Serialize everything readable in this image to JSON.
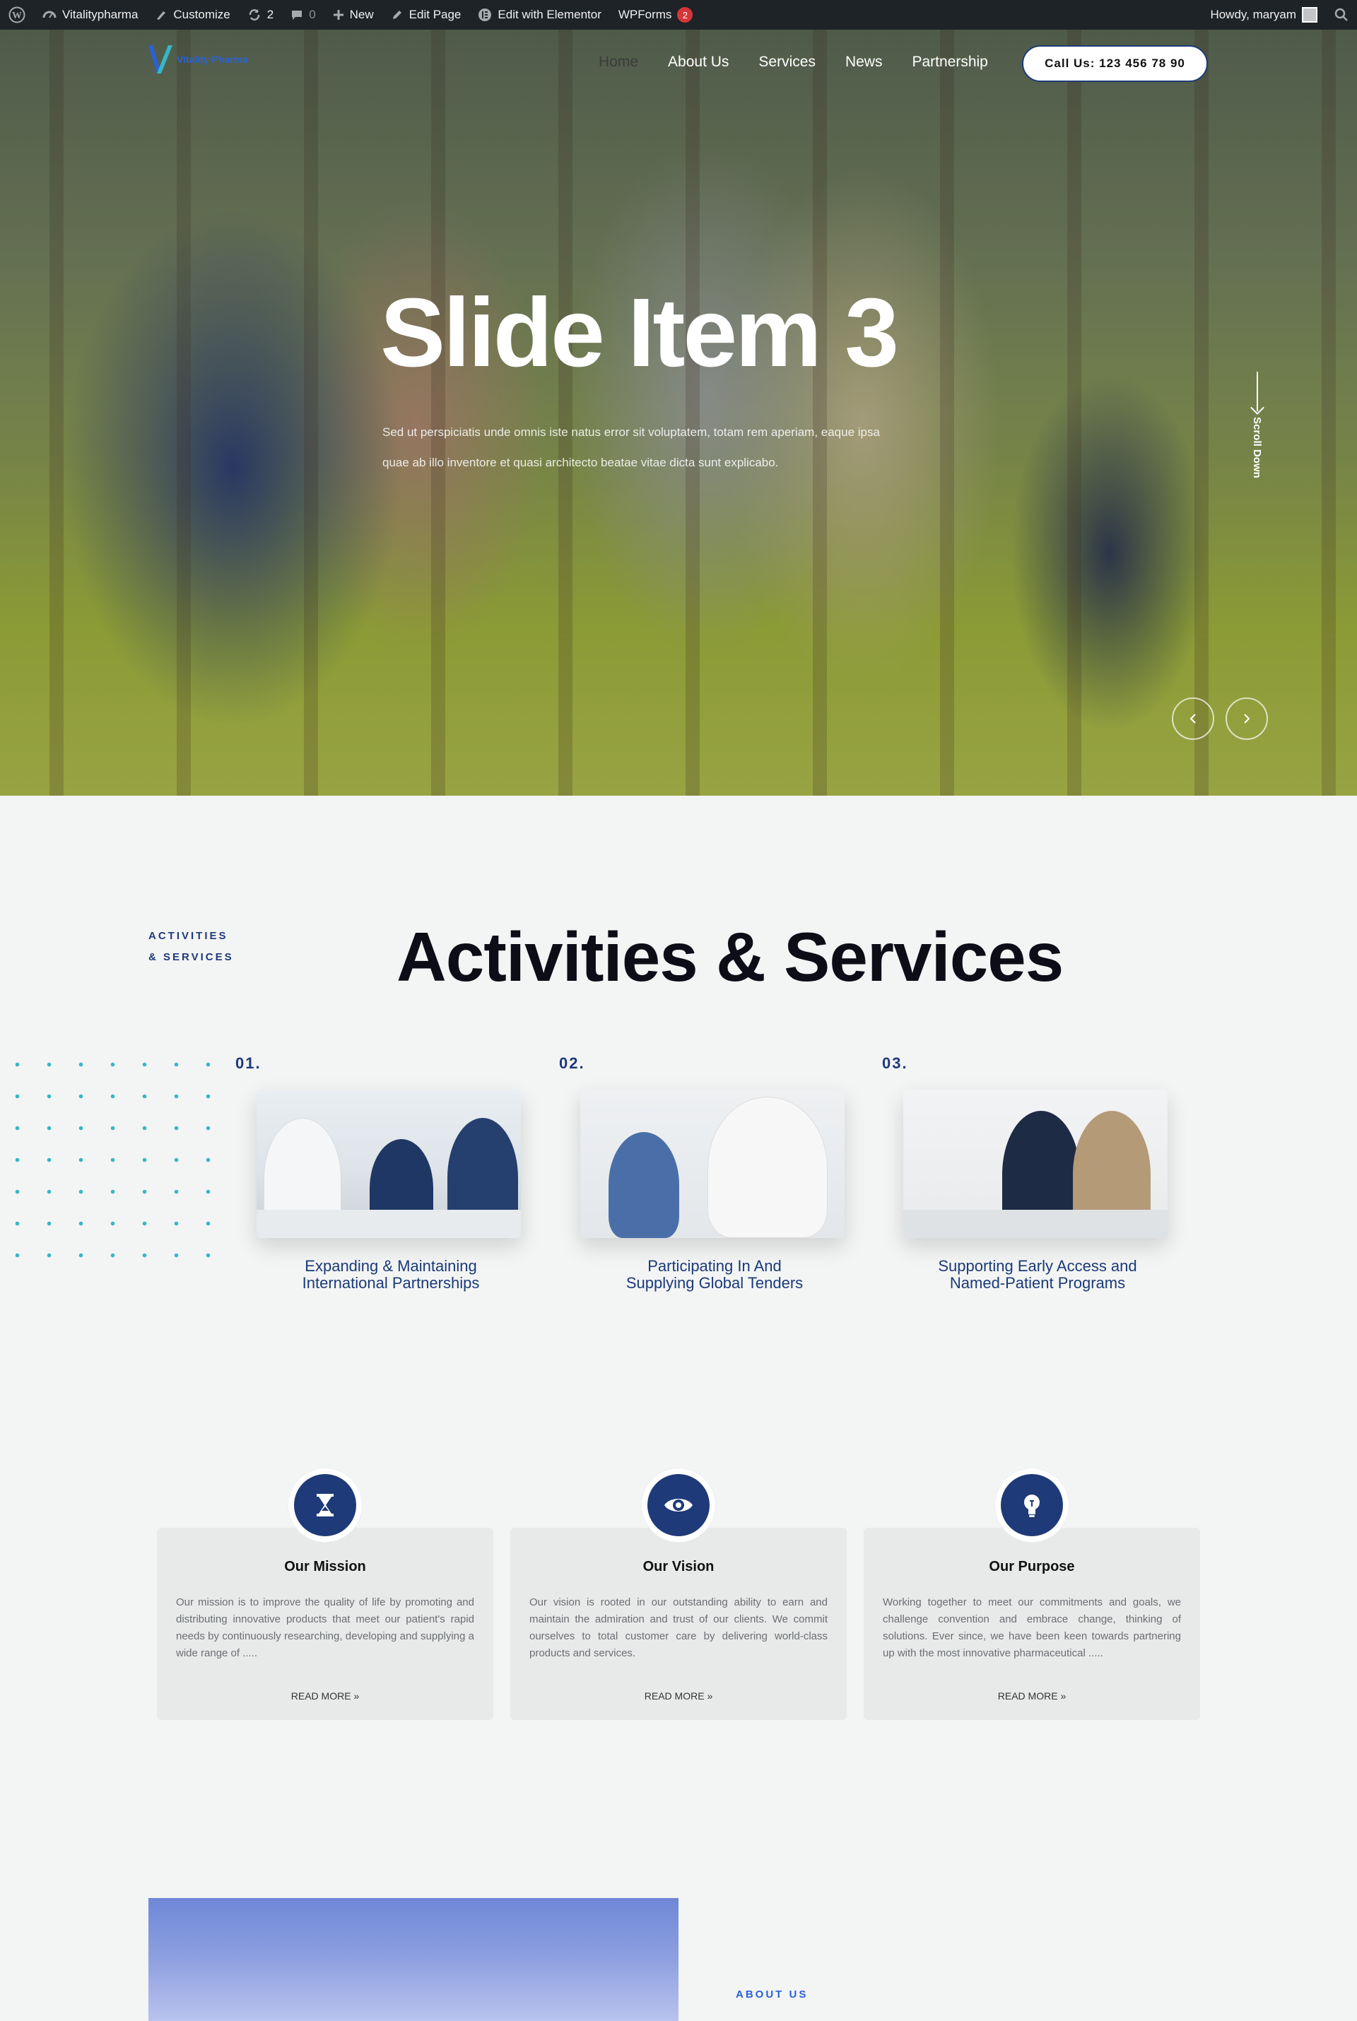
{
  "adminbar": {
    "site_name": "Vitalitypharma",
    "customize": "Customize",
    "updates_count": "2",
    "comments_count": "0",
    "new": "New",
    "edit_page": "Edit Page",
    "edit_elementor": "Edit with Elementor",
    "wpforms": "WPForms",
    "wpforms_count": "2",
    "howdy": "Howdy, maryam"
  },
  "header": {
    "logo_text": "Vitality Pharma",
    "nav": [
      "Home",
      "About Us",
      "Services",
      "News",
      "Partnership"
    ],
    "call_button": "Call Us: 123 456 78 90"
  },
  "hero": {
    "title": "Slide Item 3",
    "text": "Sed ut perspiciatis unde omnis iste natus error sit voluptatem, totam rem aperiam, eaque ipsa quae ab illo inventore et quasi architecto beatae vitae dicta sunt explicabo.",
    "scroll_label": "Scroll Down",
    "prev_icon": "chevron-left-icon",
    "next_icon": "chevron-right-icon"
  },
  "activities": {
    "eyebrow_line1": "ACTIVITIES",
    "eyebrow_line2": "& SERVICES",
    "title": "Activities & Services",
    "items": [
      {
        "num": "01.",
        "caption_line1": "Expanding & Maintaining",
        "caption_line2": "International Partnerships"
      },
      {
        "num": "02.",
        "caption_line1": "Participating In And",
        "caption_line2": "Supplying Global Tenders"
      },
      {
        "num": "03.",
        "caption_line1": "Supporting Early Access and",
        "caption_line2": "Named-Patient Programs"
      }
    ]
  },
  "cards": [
    {
      "icon": "hourglass-icon",
      "title": "Our Mission",
      "body": "Our mission is to improve the quality of life by promoting and distributing innovative products that meet our patient's rapid needs by continuously researching, developing and supplying a wide range of .....",
      "more": "READ MORE"
    },
    {
      "icon": "eye-icon",
      "title": "Our Vision",
      "body": "Our vision is rooted in our outstanding ability to earn and maintain the admiration and trust of our clients. We commit ourselves to total customer care by delivering world-class products and services.",
      "more": "READ MORE"
    },
    {
      "icon": "lightbulb-icon",
      "title": "Our Purpose",
      "body": "Working together to meet our commitments and goals, we challenge convention and embrace change, thinking of solutions. Ever since, we have been keen towards partnering up with the most innovative pharmaceutical .....",
      "more": "READ MORE"
    }
  ],
  "about": {
    "eyebrow": "ABOUT US"
  },
  "colors": {
    "brand_navy": "#1e3a78",
    "accent_teal": "#36b6c9",
    "adminbar_bg": "#1d2327"
  }
}
